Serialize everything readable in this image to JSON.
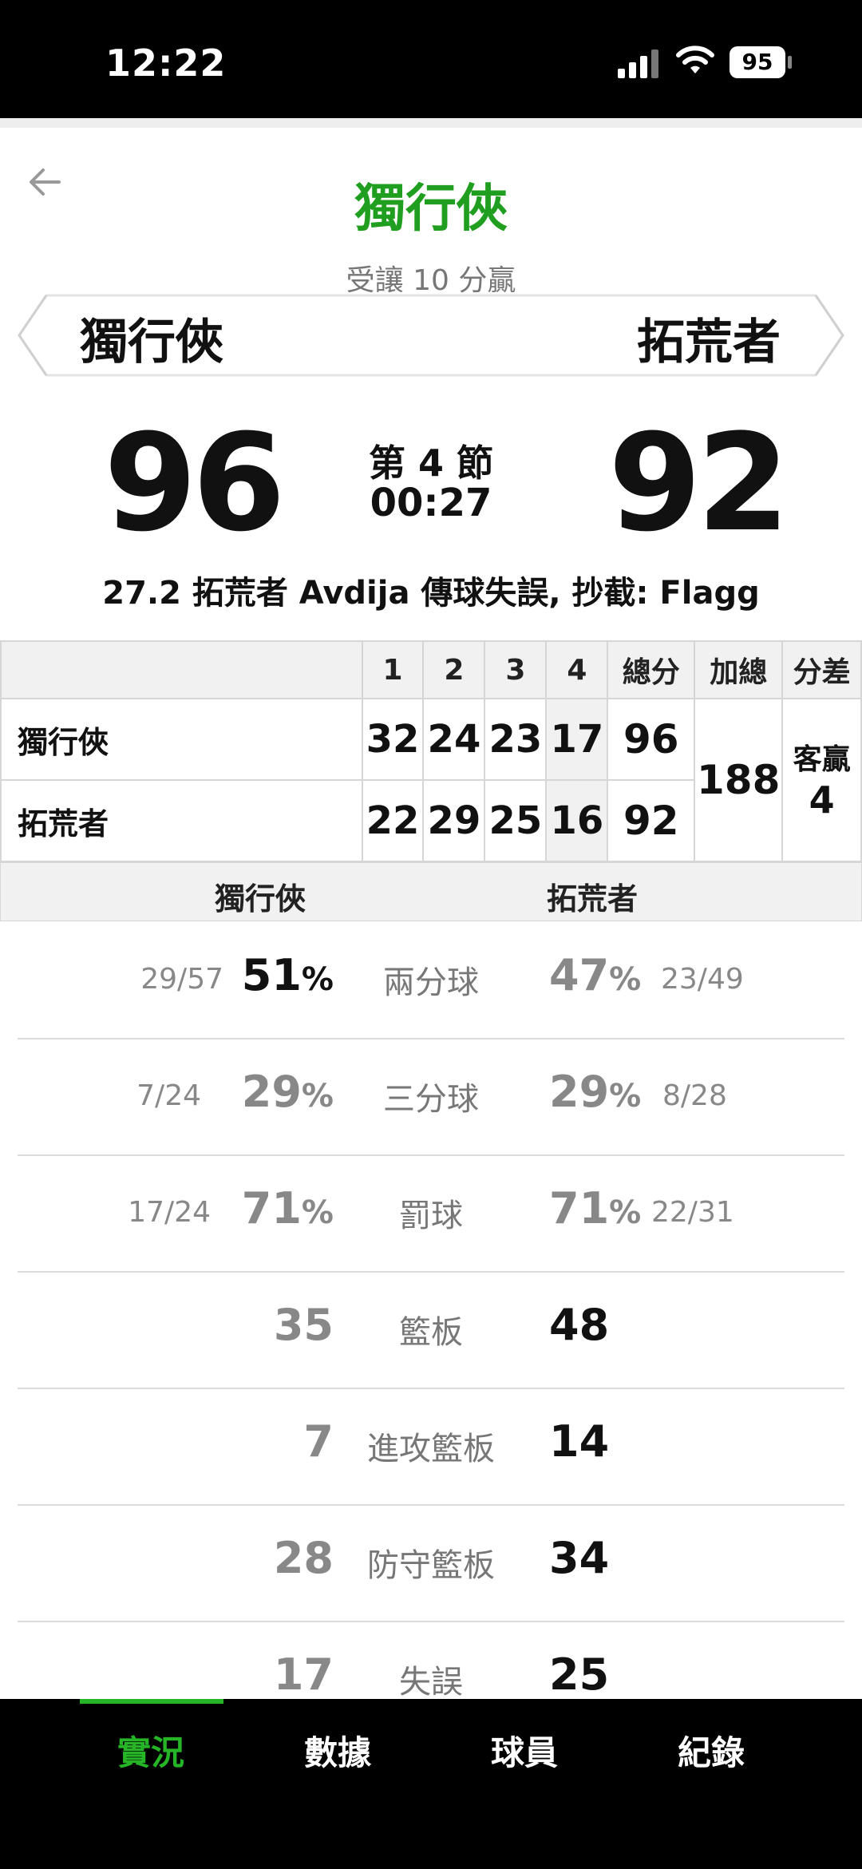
{
  "status_bar": {
    "time": "12:22",
    "battery": "95"
  },
  "header": {
    "title": "獨行俠",
    "handicap": "受讓 10 分贏",
    "team_home": "獨行俠",
    "team_away": "拓荒者"
  },
  "scoreboard": {
    "home_score": "96",
    "away_score": "92",
    "period": "第 4 節",
    "clock": "00:27",
    "last_play": "27.2 拓荒者 Avdija 傳球失誤, 抄截: Flagg"
  },
  "boxscore": {
    "headers": [
      "1",
      "2",
      "3",
      "4",
      "總分",
      "加總",
      "分差"
    ],
    "rows": [
      {
        "team": "獨行俠",
        "q": [
          "32",
          "24",
          "23",
          "17"
        ],
        "total": "96"
      },
      {
        "team": "拓荒者",
        "q": [
          "22",
          "29",
          "25",
          "16"
        ],
        "total": "92"
      }
    ],
    "sum": "188",
    "diff_label": "客贏",
    "diff_value": "4"
  },
  "stats": {
    "header_home": "獨行俠",
    "header_away": "拓荒者",
    "rows": [
      {
        "category": "兩分球",
        "home_frac": "29/57",
        "home_val": "51",
        "home_pct": "%",
        "away_val": "47",
        "away_pct": "%",
        "away_frac": "23/49"
      },
      {
        "category": "三分球",
        "home_frac": "7/24",
        "home_val": "29",
        "home_pct": "%",
        "away_val": "29",
        "away_pct": "%",
        "away_frac": "8/28"
      },
      {
        "category": "罰球",
        "home_frac": "17/24",
        "home_val": "71",
        "home_pct": "%",
        "away_val": "71",
        "away_pct": "%",
        "away_frac": "22/31"
      },
      {
        "category": "籃板",
        "home_val": "35",
        "away_val": "48"
      },
      {
        "category": "進攻籃板",
        "home_val": "7",
        "away_val": "14"
      },
      {
        "category": "防守籃板",
        "home_val": "28",
        "away_val": "34"
      },
      {
        "category": "失誤",
        "home_val": "17",
        "away_val": "25"
      }
    ]
  },
  "bottom_nav": {
    "tabs": [
      "實況",
      "數據",
      "球員",
      "紀錄"
    ],
    "active": "實況"
  },
  "colors": {
    "accent": "#26b526",
    "title_green": "#1f9e1f"
  }
}
